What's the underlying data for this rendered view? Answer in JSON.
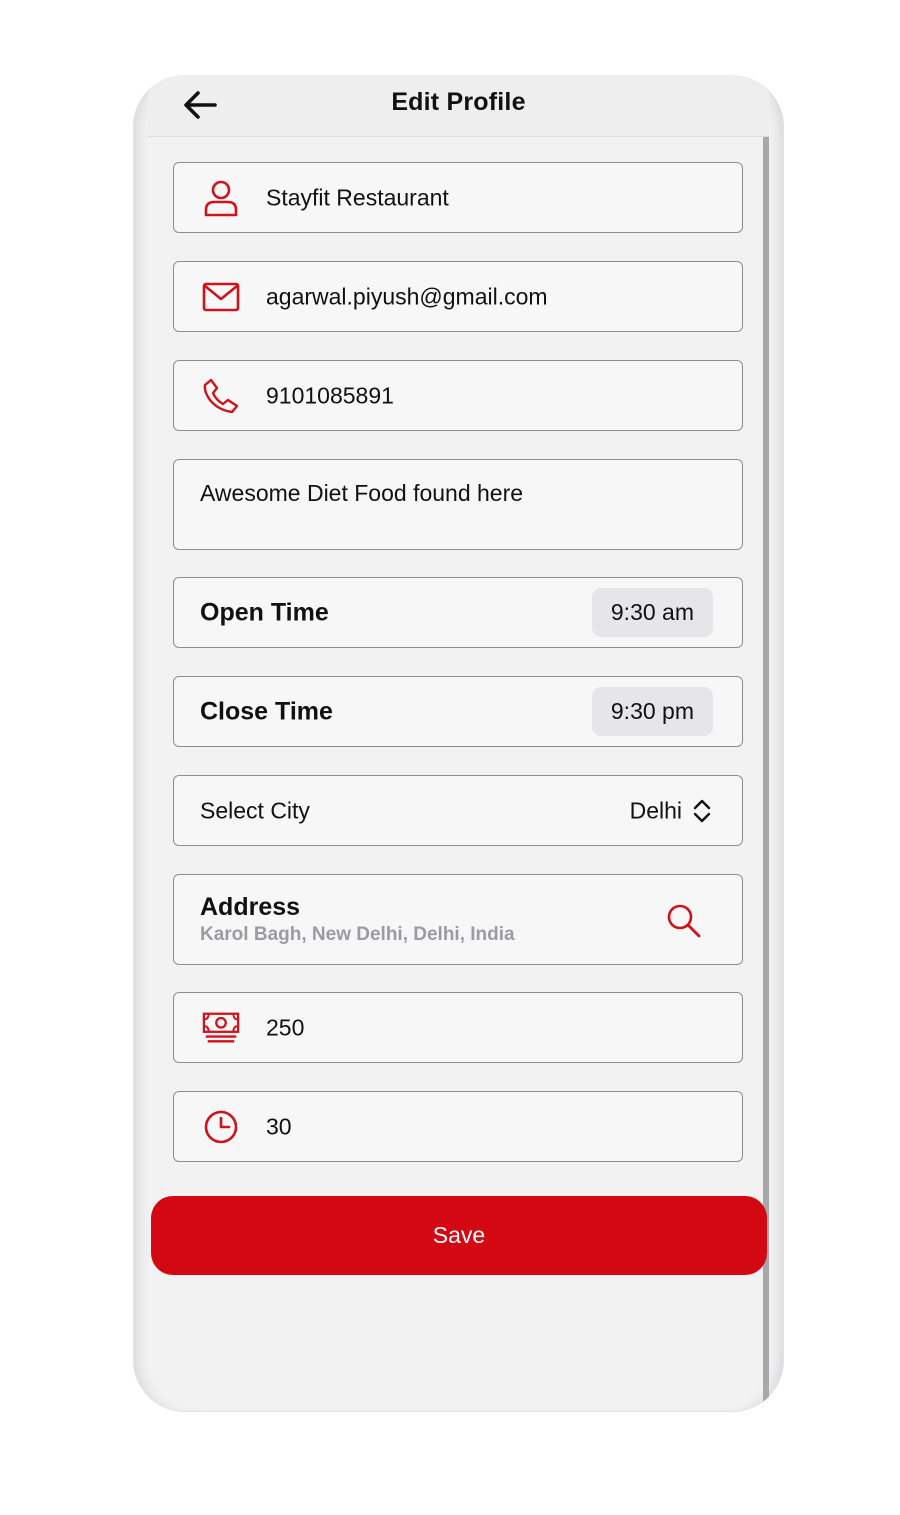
{
  "header": {
    "title": "Edit Profile",
    "back_icon": "arrow-left-icon"
  },
  "colors": {
    "accent": "#d30812",
    "icon": "#d0121b",
    "muted_text": "#9c9ca0"
  },
  "form": {
    "name": {
      "value": "Stayfit Restaurant",
      "icon": "user-icon"
    },
    "email": {
      "value": "agarwal.piyush@gmail.com",
      "icon": "mail-icon"
    },
    "phone": {
      "value": "9101085891",
      "icon": "phone-icon"
    },
    "description": {
      "value": "Awesome Diet Food found here"
    },
    "open_time": {
      "label": "Open Time",
      "value": "9:30 am"
    },
    "close_time": {
      "label": "Close Time",
      "value": "9:30 pm"
    },
    "city": {
      "label": "Select City",
      "value": "Delhi",
      "icon": "chevron-up-down-icon"
    },
    "address": {
      "label": "Address",
      "value": "Karol Bagh, New Delhi, Delhi, India",
      "icon": "search-icon"
    },
    "price": {
      "value": "250",
      "icon": "money-icon"
    },
    "time": {
      "value": "30",
      "icon": "clock-icon"
    }
  },
  "save_label": "Save"
}
